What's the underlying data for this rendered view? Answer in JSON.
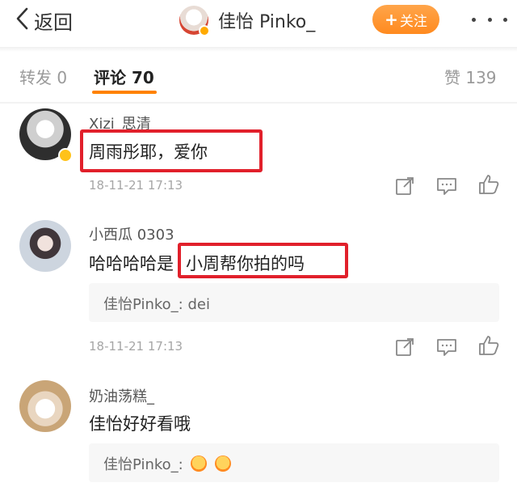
{
  "header": {
    "back_label": "返回",
    "profile_name": "佳怡 Pinko_",
    "follow_label": "关注",
    "follow_plus": "+"
  },
  "tabs": {
    "repost": "转发 0",
    "comment": "评论 70",
    "like": "赞 139"
  },
  "comments": [
    {
      "username": "Xizi_思清",
      "text": "周雨彤耶，爱你",
      "time": "18-11-21 17:13"
    },
    {
      "username": "小西瓜 0303",
      "text_prefix": "哈哈哈哈是",
      "text_highlight": "小周帮你拍的吗",
      "reply": "佳怡Pinko_: dei",
      "time": "18-11-21 17:13"
    },
    {
      "username": "奶油荡糕_",
      "text": "佳怡好好看哦",
      "reply": "佳怡Pinko_:"
    }
  ],
  "colors": {
    "accent_orange": "#ff8200",
    "highlight_red": "#e1202b"
  }
}
